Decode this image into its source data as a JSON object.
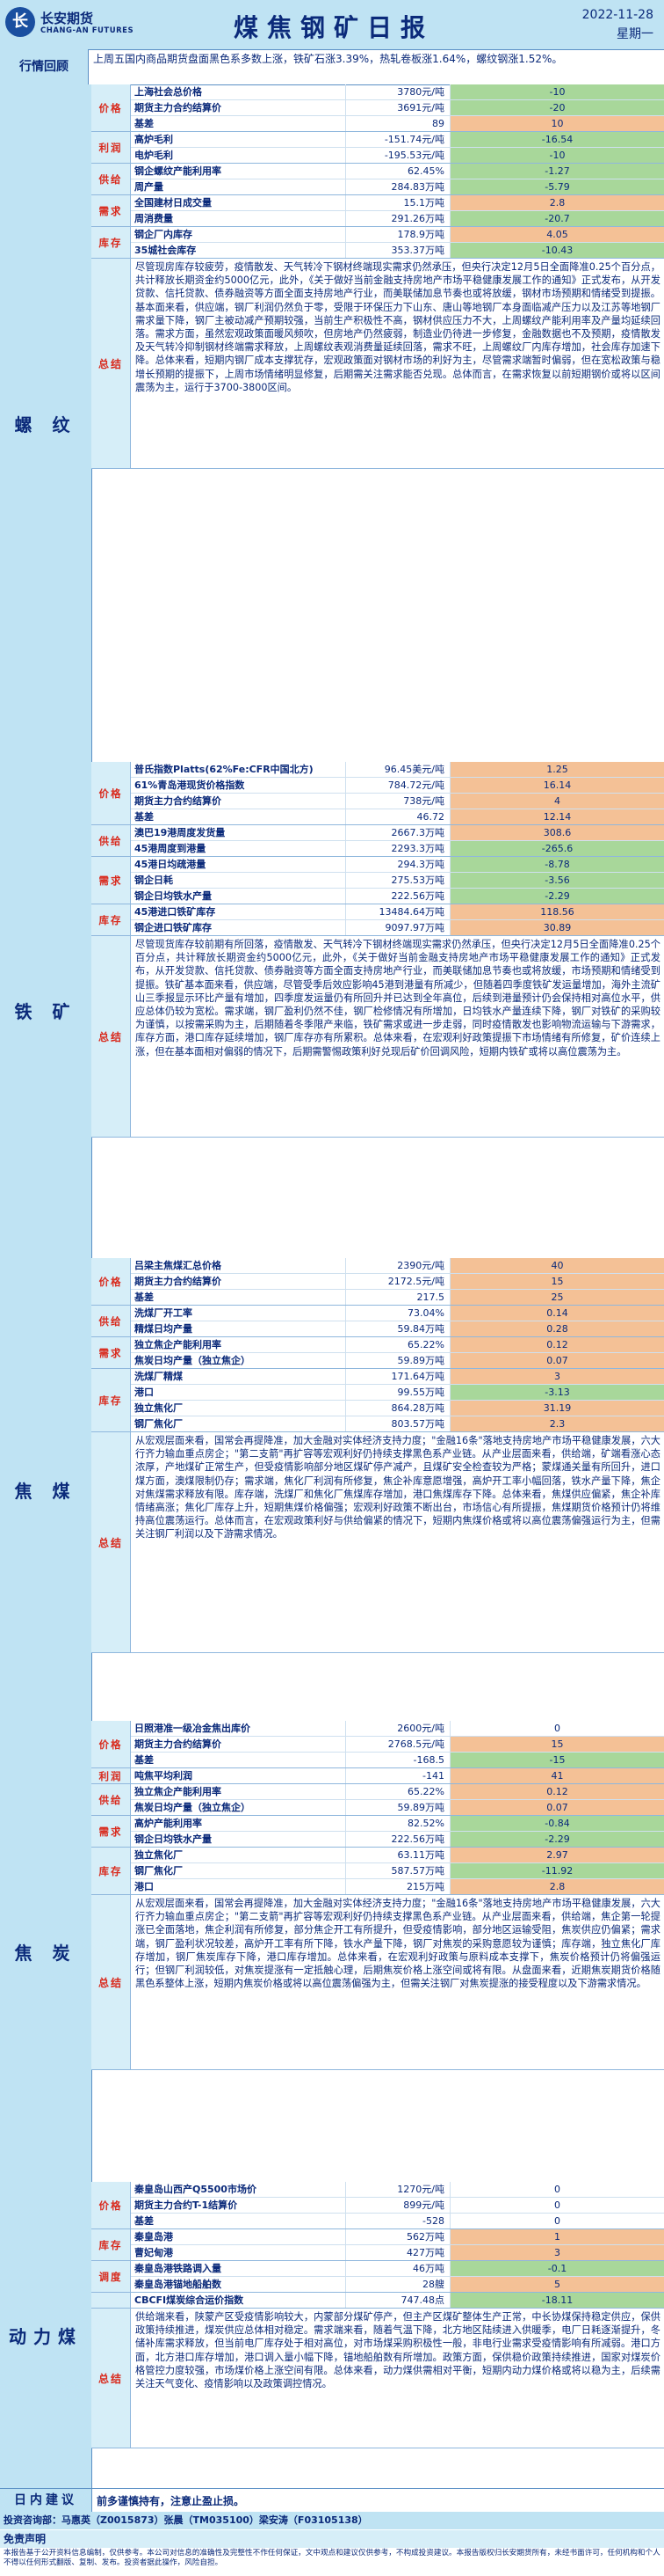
{
  "header": {
    "logo_cn": "长安期货",
    "logo_en": "CHANG-AN FUTURES",
    "title": "煤焦钢矿日报",
    "date": "2022-11-28",
    "weekday": "星期一"
  },
  "review": {
    "label": "行情回顾",
    "text": "上周五国内商品期货盘面黑色系多数上涨，铁矿石涨3.39%，热轧卷板涨1.64%，螺纹钢涨1.52%。"
  },
  "sections": [
    {
      "name": "螺 纹",
      "groups": [
        {
          "label": "价格",
          "rows": [
            [
              "上海社会总价格",
              "3780元/吨",
              "-10",
              "neg"
            ],
            [
              "期货主力合约结算价",
              "3691元/吨",
              "-20",
              "neg"
            ],
            [
              "基差",
              "89",
              "10",
              "pos"
            ]
          ]
        },
        {
          "label": "利润",
          "rows": [
            [
              "高炉毛利",
              "-151.74元/吨",
              "-16.54",
              "neg"
            ],
            [
              "电炉毛利",
              "-195.53元/吨",
              "-10",
              "neg"
            ]
          ]
        },
        {
          "label": "供给",
          "rows": [
            [
              "钢企螺纹产能利用率",
              "62.45%",
              "-1.27",
              "neg"
            ],
            [
              "周产量",
              "284.83万吨",
              "-5.79",
              "neg"
            ]
          ]
        },
        {
          "label": "需求",
          "rows": [
            [
              "全国建材日成交量",
              "15.1万吨",
              "2.8",
              "pos"
            ],
            [
              "周消费量",
              "291.26万吨",
              "-20.7",
              "neg"
            ]
          ]
        },
        {
          "label": "库存",
          "rows": [
            [
              "钢企厂内库存",
              "178.9万吨",
              "4.05",
              "pos"
            ],
            [
              "35城社会库存",
              "353.37万吨",
              "-10.43",
              "neg"
            ]
          ]
        }
      ],
      "summary": "尽管现房库存较疲劳，疫情散发、天气转冷下钢材终端现实需求仍然承压，但央行决定12月5日全面降准0.25个百分点，共计释放长期资金约5000亿元，此外，《关于做好当前金融支持房地产市场平稳健康发展工作的通知》正式发布，从开发贷款、信托贷款、债券融资等方面全面支持房地产行业，而美联储加息节奏也或将放缓，钢材市场预期和情绪受到提振。基本面来看，供应端，钢厂利润仍然负于零，受限于环保压力下山东、唐山等地钢厂本身面临减产压力以及江苏等地钢厂需求量下降，钢厂主被动减产预期较强，当前生产积极性不高，钢材供应压力不大，上周螺纹产能利用率及产量均延续回落。需求方面，虽然宏观政策面暖风频吹，但房地产仍然疲弱，制造业仍待进一步修复，金融数据也不及预期，疫情散发及天气转冷抑制钢材终端需求释放，上周螺纹表观消费量延续回落，需求不旺，上周螺纹厂内库存增加，社会库存加速下降。总体来看，短期内钢厂成本支撑犹存，宏观政策面对钢材市场的利好为主，尽管需求端暂时偏弱，但在宽松政策与稳增长预期的提振下，上周市场情绪明显修复，后期需关注需求能否兑现。总体而言，在需求恢复以前短期钢价或将以区间震荡为主，运行于3700-3800区间。",
      "summary_y": 0
    },
    {
      "name": "铁 矿",
      "groups": [
        {
          "label": "价格",
          "rows": [
            [
              "普氏指数Platts(62%Fe:CFR中国北方)",
              "96.45美元/吨",
              "1.25",
              "pos"
            ],
            [
              "61%青岛港现货价格指数",
              "784.72元/吨",
              "16.14",
              "pos"
            ],
            [
              "期货主力合约结算价",
              "738元/吨",
              "4",
              "pos"
            ],
            [
              "基差",
              "46.72",
              "12.14",
              "pos"
            ]
          ]
        },
        {
          "label": "供给",
          "rows": [
            [
              "澳巴19港周度发货量",
              "2667.3万吨",
              "308.6",
              "pos"
            ],
            [
              "45港周度到港量",
              "2293.3万吨",
              "-265.6",
              "neg"
            ]
          ]
        },
        {
          "label": "需求",
          "rows": [
            [
              "45港日均疏港量",
              "294.3万吨",
              "-8.78",
              "neg"
            ],
            [
              "钢企日耗",
              "275.53万吨",
              "-3.56",
              "neg"
            ],
            [
              "钢企日均铁水产量",
              "222.56万吨",
              "-2.29",
              "neg"
            ]
          ]
        },
        {
          "label": "库存",
          "rows": [
            [
              "45港进口铁矿库存",
              "13484.64万吨",
              "118.56",
              "pos"
            ],
            [
              "钢企进口铁矿库存",
              "9097.97万吨",
              "30.89",
              "pos"
            ]
          ]
        }
      ],
      "summary": "尽管现货库存较前期有所回落，疫情散发、天气转冷下钢材终端现实需求仍然承压，但央行决定12月5日全面降准0.25个百分点，共计释放长期资金约5000亿元，此外，《关于做好当前金融支持房地产市场平稳健康发展工作的通知》正式发布，从开发贷款、信托贷款、债券融资等方面全面支持房地产行业，而美联储加息节奏也或将放缓，市场预期和情绪受到提振。铁矿基本面来看，供应端，尽管受季后效应影响45港到港量有所减少，但随着四季度铁矿发运量增加，海外主流矿山三季报显示环比产量有增加，四季度发运量仍有所回升并已达到全年高位，后续到港量预计仍会保持相对高位水平，供应总体仍较为宽松。需求端，钢厂盈利仍然不佳，钢厂检修情况有所增加，日均铁水产量连续下降，钢厂对铁矿的采购较为谨慎，以按需采购为主，后期随着冬季限产来临，铁矿需求或进一步走弱，同时疫情散发也影响物流运输与下游需求，库存方面，港口库存延续增加，钢厂库存亦有所累积。总体来看，在宏观利好政策提振下市场情绪有所修复，矿价连续上涨，但在基本面相对偏弱的情况下，后期需警惕政策利好兑现后矿价回调风险，短期内铁矿或将以高位震荡为主。",
      "summary_y": 0
    },
    {
      "name": "焦 煤",
      "groups": [
        {
          "label": "价格",
          "rows": [
            [
              "吕梁主焦煤汇总价格",
              "2390元/吨",
              "40",
              "pos"
            ],
            [
              "期货主力合约结算价",
              "2172.5元/吨",
              "15",
              "pos"
            ],
            [
              "基差",
              "217.5",
              "25",
              "pos"
            ]
          ]
        },
        {
          "label": "供给",
          "rows": [
            [
              "洗煤厂开工率",
              "73.04%",
              "0.14",
              "pos"
            ],
            [
              "精煤日均产量",
              "59.84万吨",
              "0.28",
              "pos"
            ]
          ]
        },
        {
          "label": "需求",
          "rows": [
            [
              "独立焦企产能利用率",
              "65.22%",
              "0.12",
              "pos"
            ],
            [
              "焦炭日均产量（独立焦企）",
              "59.89万吨",
              "0.07",
              "pos"
            ]
          ]
        },
        {
          "label": "库存",
          "rows": [
            [
              "洗煤厂精煤",
              "171.64万吨",
              "3",
              "pos"
            ],
            [
              "港口",
              "99.55万吨",
              "-3.13",
              "neg"
            ],
            [
              "独立焦化厂",
              "864.28万吨",
              "31.19",
              "pos"
            ],
            [
              "钢厂焦化厂",
              "803.57万吨",
              "2.3",
              "pos"
            ]
          ]
        }
      ],
      "summary": "从宏观层面来看，国常会再提降准，加大金融对实体经济支持力度；\"金融16条\"落地支持房地产市场平稳健康发展，六大行齐力输血重点房企；\"第二支箭\"再扩容等宏观利好仍持续支撑黑色系产业链。从产业层面来看，供给端，矿端看涨心态浓厚，产地煤矿正常生产，但受疫情影响部分地区煤矿停产减产，且煤矿安全检查较为严格；蒙煤通关量有所回升，进口煤方面，澳煤限制仍存；需求端，焦化厂利润有所修复，焦企补库意愿增强，高炉开工率小幅回落，铁水产量下降，焦企对焦煤需求释放有限。库存端，洗煤厂和焦化厂焦煤库存增加，港口焦煤库存下降。总体来看，焦煤供应偏紧，焦企补库情绪高涨；焦化厂库存上升，短期焦煤价格偏强；宏观利好政策不断出台，市场信心有所提振，焦煤期货价格预计仍将维持高位震荡运行。总体而言，在宏观政策利好与供给偏紧的情况下，短期内焦煤价格或将以高位震荡偏强运行为主，但需关注钢厂利润以及下游需求情况。",
      "summary_y": 0
    },
    {
      "name": "焦 炭",
      "groups": [
        {
          "label": "价格",
          "rows": [
            [
              "日照港准一级冶金焦出库价",
              "2600元/吨",
              "0",
              ""
            ],
            [
              "期货主力合约结算价",
              "2768.5元/吨",
              "15",
              "pos"
            ],
            [
              "基差",
              "-168.5",
              "-15",
              "neg"
            ]
          ]
        },
        {
          "label": "利润",
          "rows": [
            [
              "吨焦平均利润",
              "-141",
              "41",
              "pos"
            ]
          ]
        },
        {
          "label": "供给",
          "rows": [
            [
              "独立焦企产能利用率",
              "65.22%",
              "0.12",
              "pos"
            ],
            [
              "焦炭日均产量（独立焦企）",
              "59.89万吨",
              "0.07",
              "pos"
            ]
          ]
        },
        {
          "label": "需求",
          "rows": [
            [
              "高炉产能利用率",
              "82.52%",
              "-0.84",
              "neg"
            ],
            [
              "钢企日均铁水产量",
              "222.56万吨",
              "-2.29",
              "neg"
            ]
          ]
        },
        {
          "label": "库存",
          "rows": [
            [
              "独立焦化厂",
              "63.11万吨",
              "2.97",
              "pos"
            ],
            [
              "钢厂焦化厂",
              "587.57万吨",
              "-11.92",
              "neg"
            ],
            [
              "港口",
              "215万吨",
              "2.8",
              "pos"
            ]
          ]
        }
      ],
      "summary": "从宏观层面来看，国常会再提降准，加大金融对实体经济支持力度；\"金融16条\"落地支持房地产市场平稳健康发展，六大行齐力输血重点房企；\"第二支箭\"再扩容等宏观利好仍持续支撑黑色系产业链。从产业层面来看，供给端，焦企第一轮提涨已全面落地，焦企利润有所修复，部分焦企开工有所提升，但受疫情影响，部分地区运输受阻，焦炭供应仍偏紧；需求端，钢厂盈利状况较差，高炉开工率有所下降，铁水产量下降，钢厂对焦炭的采购意愿较为谨慎；库存端，独立焦化厂库存增加，钢厂焦炭库存下降，港口库存增加。总体来看，在宏观利好政策与原料成本支撑下，焦炭价格预计仍将偏强运行；但钢厂利润较低，对焦炭提涨有一定抵触心理，后期焦炭价格上涨空间或将有限。从盘面来看，近期焦炭期货价格随黑色系整体上涨，短期内焦炭价格或将以高位震荡偏强为主，但需关注钢厂对焦炭提涨的接受程度以及下游需求情况。",
      "summary_y": 0
    },
    {
      "name": "动力煤",
      "groups": [
        {
          "label": "价格",
          "rows": [
            [
              "秦皇岛山西产Q5500市场价",
              "1270元/吨",
              "0",
              ""
            ],
            [
              "期货主力合约T-1结算价",
              "899元/吨",
              "0",
              ""
            ],
            [
              "基差",
              "-528",
              "0",
              ""
            ]
          ]
        },
        {
          "label": "库存",
          "rows": [
            [
              "秦皇岛港",
              "562万吨",
              "1",
              "pos"
            ],
            [
              "曹妃甸港",
              "427万吨",
              "3",
              "pos"
            ]
          ]
        },
        {
          "label": "调度",
          "rows": [
            [
              "秦皇岛港铁路调入量",
              "46万吨",
              "-0.1",
              "neg"
            ],
            [
              "秦皇岛港锚地船舶数",
              "28艘",
              "5",
              "pos"
            ]
          ]
        },
        {
          "label": "",
          "rows": [
            [
              "CBCFI煤炭综合运价指数",
              "747.48点",
              "-18.11",
              "neg"
            ]
          ]
        }
      ],
      "summary": "供给端来看，陕蒙产区受疫情影响较大，内蒙部分煤矿停产，但主产区煤矿整体生产正常，中长协煤保持稳定供应，保供政策持续推进，煤炭供应总体相对稳定。需求端来看，随着气温下降，北方地区陆续进入供暖季，电厂日耗逐渐提升，冬储补库需求释放，但当前电厂库存处于相对高位，对市场煤采购积极性一般，非电行业需求受疫情影响有所减弱。港口方面，北方港口库存增加，港口调入量小幅下降，锚地船舶数有所增加。政策方面，保供稳价政策持续推进，国家对煤炭价格管控力度较强，市场煤价格上涨空间有限。总体来看，动力煤供需相对平衡，短期内动力煤价格或将以稳为主，后续需关注天气变化、疫情影响以及政策调控情况。",
      "summary_y": 0
    }
  ],
  "advice": {
    "label": "日内建议",
    "text": "前多谨慎持有，注意止盈止损。"
  },
  "consultants": "投资咨询部：马惠英（Z0015873）张晨（TM035100）梁安涛（F03105138）",
  "disclaimer_title": "免责声明",
  "disclaimer": "本报告基于公开资料信息编制，仅供参考。本公司对信息的准确性及完整性不作任何保证，文中观点和建议仅供参考，不构成投资建议。本报告版权归长安期货所有，未经书面许可，任何机构和个人不得以任何形式翻版、复制、发布。投资者据此操作，风险自担。"
}
